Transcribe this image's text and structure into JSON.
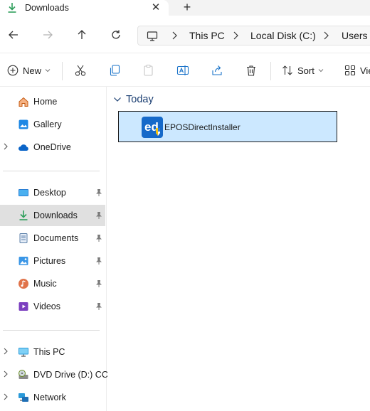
{
  "window": {
    "tab_title": "Downloads",
    "tab_close": "✕",
    "new_tab": "+"
  },
  "address": {
    "crumbs": [
      "This PC",
      "Local Disk (C:)",
      "Users"
    ]
  },
  "commands": {
    "new_label": "New",
    "sort_label": "Sort",
    "view_label": "View"
  },
  "sidebar": {
    "items": [
      {
        "label": "Home",
        "icon": "home-icon"
      },
      {
        "label": "Gallery",
        "icon": "gallery-icon"
      },
      {
        "label": "OneDrive",
        "icon": "cloud-icon"
      },
      {
        "label": "Desktop",
        "icon": "desktop-icon"
      },
      {
        "label": "Downloads",
        "icon": "download-icon"
      },
      {
        "label": "Documents",
        "icon": "documents-icon"
      },
      {
        "label": "Pictures",
        "icon": "pictures-icon"
      },
      {
        "label": "Music",
        "icon": "music-icon"
      },
      {
        "label": "Videos",
        "icon": "videos-icon"
      },
      {
        "label": "This PC",
        "icon": "computer-icon"
      },
      {
        "label": "DVD Drive (D:) CCC",
        "icon": "dvd-drive-icon"
      },
      {
        "label": "Network",
        "icon": "network-icon"
      }
    ]
  },
  "content": {
    "group_label": "Today",
    "files": [
      {
        "name": "EPOSDirectInstaller",
        "icon": "epos-installer-icon"
      }
    ]
  },
  "colors": {
    "selection": "#cce8ff",
    "sidebar_selected": "#e0e0e0",
    "accent": "#0067c0"
  }
}
